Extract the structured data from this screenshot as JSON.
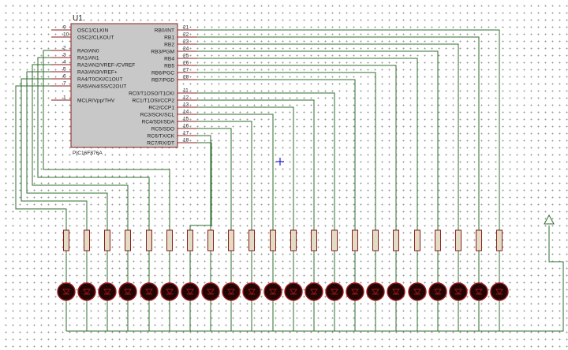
{
  "chip": {
    "ref": "U1",
    "part": "PIC16F876A",
    "left_pins": [
      {
        "num": "9",
        "name": "OSC1/CLKIN"
      },
      {
        "num": "10",
        "name": "OSC2/CLKOUT"
      },
      {
        "num": "2",
        "name": "RA0/AN0"
      },
      {
        "num": "3",
        "name": "RA1/AN1"
      },
      {
        "num": "4",
        "name": "RA2/AN2/VREF-/CVREF"
      },
      {
        "num": "5",
        "name": "RA3/AN3/VREF+"
      },
      {
        "num": "6",
        "name": "RA4/T0CKI/C1OUT"
      },
      {
        "num": "7",
        "name": "RA5/AN4/SS/C2OUT"
      },
      {
        "num": "1",
        "name": "MCLR/Vpp/THV"
      }
    ],
    "right_pins": [
      {
        "num": "21",
        "name": "RB0/INT"
      },
      {
        "num": "22",
        "name": "RB1"
      },
      {
        "num": "23",
        "name": "RB2"
      },
      {
        "num": "24",
        "name": "RB3/PGM"
      },
      {
        "num": "25",
        "name": "RB4"
      },
      {
        "num": "26",
        "name": "RB5"
      },
      {
        "num": "27",
        "name": "RB6/PGC"
      },
      {
        "num": "28",
        "name": "RB7/PGD"
      },
      {
        "num": "11",
        "name": "RC0/T1OSO/T1CKI"
      },
      {
        "num": "12",
        "name": "RC1/T1OSI/CCP2"
      },
      {
        "num": "13",
        "name": "RC2/CCP1"
      },
      {
        "num": "14",
        "name": "RC3/SCK/SCL"
      },
      {
        "num": "15",
        "name": "RC4/SDI/SDA"
      },
      {
        "num": "16",
        "name": "RC5/SDO"
      },
      {
        "num": "17",
        "name": "RC6/TX/CK"
      },
      {
        "num": "18",
        "name": "RC7/RX/DT"
      }
    ]
  },
  "colors": {
    "wire": "#2d6e2d",
    "chip_fill": "#c8c8c8",
    "chip_border": "#8b1e1e",
    "pin": "#8b1e1e",
    "resistor_fill": "#e2dcc4",
    "resistor_border": "#8b1e1e",
    "led_fill": "#220505",
    "led_border": "#a01818",
    "ground": "#2d6e2d",
    "cursor": "#2222cc"
  }
}
